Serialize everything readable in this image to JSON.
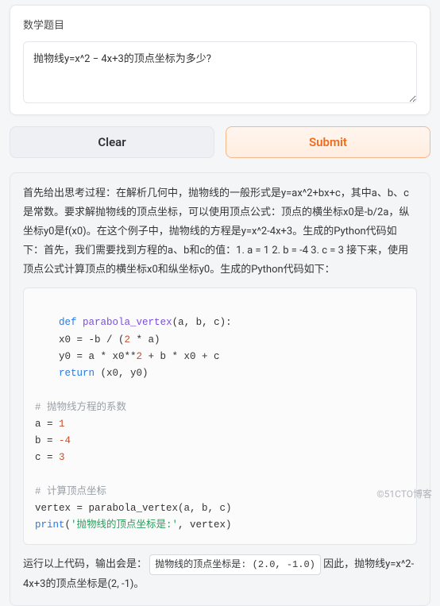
{
  "input_card": {
    "label": "数学题目",
    "value": "抛物线y=x^2 − 4x+3的顶点坐标为多少?"
  },
  "buttons": {
    "clear": "Clear",
    "submit": "Submit"
  },
  "answer": {
    "explain": "首先给出思考过程：在解析几何中，抛物线的一般形式是y=ax^2+bx+c，其中a、b、c是常数。要求解抛物线的顶点坐标，可以使用顶点公式：顶点的横坐标x0是-b/2a，纵坐标y0是f(x0)。在这个例子中，抛物线的方程是y=x^2-4x+3。生成的Python代码如下：首先，我们需要找到方程的a、b和c的值：1. a = 1 2. b = -4 3. c = 3 接下来，使用顶点公式计算顶点的横坐标x0和纵坐标y0。生成的Python代码如下：",
    "tail_prefix": "运行以上代码，输出会是：",
    "output_box": "抛物线的顶点坐标是: (2.0, -1.0)",
    "tail_suffix": " 因此，抛物线y=x^2-4x+3的顶点坐标是(2, -1)。"
  },
  "code": {
    "kw_def": "def",
    "fn_name": "parabola_vertex",
    "params": "(a, b, c):",
    "l1a": "    x0 = -b / (",
    "l1b": " * a)",
    "l2a": "    y0 = a * x0**",
    "l2b": " + b * x0 + c",
    "kw_return": "return",
    "ret_tail": " (x0, y0)",
    "num_2a": "2",
    "num_2b": "2",
    "com1": "# 抛物线方程的系数",
    "a_lhs": "a = ",
    "a_val": "1",
    "b_lhs": "b = ",
    "b_val": "-4",
    "c_lhs": "c = ",
    "c_val": "3",
    "com2": "# 计算顶点坐标",
    "vertex_line": "vertex = parabola_vertex(a, b, c)",
    "kw_print": "print",
    "print_open": "(",
    "print_str": "'抛物线的顶点坐标是:'",
    "print_tail": ", vertex)"
  },
  "watermark": "©51CTO博客"
}
